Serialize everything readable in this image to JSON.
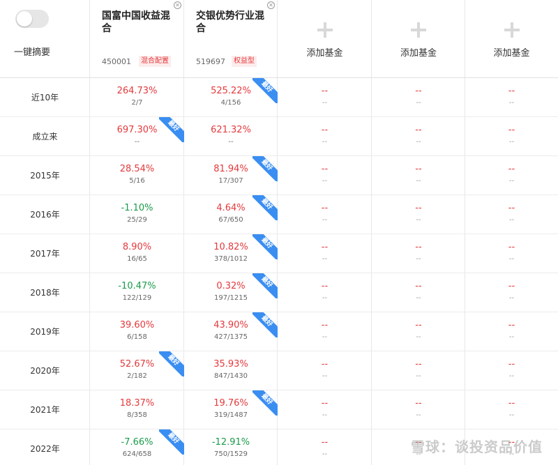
{
  "summary": {
    "label": "一键摘要"
  },
  "funds": [
    {
      "name": "国富中国收益混合",
      "code": "450001",
      "tag": "混合配置"
    },
    {
      "name": "交银优势行业混合",
      "code": "519697",
      "tag": "权益型"
    }
  ],
  "add_slot_label": "添加基金",
  "empty_value": "--",
  "badge_label": "最好",
  "rows": [
    {
      "label": "近10年",
      "f1": {
        "value": "264.73%",
        "rank": "2/7",
        "dir": "up",
        "best": false
      },
      "f2": {
        "value": "525.22%",
        "rank": "4/156",
        "dir": "up",
        "best": true
      }
    },
    {
      "label": "成立来",
      "f1": {
        "value": "697.30%",
        "rank": "--",
        "dir": "up",
        "best": true
      },
      "f2": {
        "value": "621.32%",
        "rank": "--",
        "dir": "up",
        "best": false
      }
    },
    {
      "label": "2015年",
      "f1": {
        "value": "28.54%",
        "rank": "5/16",
        "dir": "up",
        "best": false
      },
      "f2": {
        "value": "81.94%",
        "rank": "17/307",
        "dir": "up",
        "best": true
      }
    },
    {
      "label": "2016年",
      "f1": {
        "value": "-1.10%",
        "rank": "25/29",
        "dir": "down",
        "best": false
      },
      "f2": {
        "value": "4.64%",
        "rank": "67/650",
        "dir": "up",
        "best": true
      }
    },
    {
      "label": "2017年",
      "f1": {
        "value": "8.90%",
        "rank": "16/65",
        "dir": "up",
        "best": false
      },
      "f2": {
        "value": "10.82%",
        "rank": "378/1012",
        "dir": "up",
        "best": true
      }
    },
    {
      "label": "2018年",
      "f1": {
        "value": "-10.47%",
        "rank": "122/129",
        "dir": "down",
        "best": false
      },
      "f2": {
        "value": "0.32%",
        "rank": "197/1215",
        "dir": "up",
        "best": true
      }
    },
    {
      "label": "2019年",
      "f1": {
        "value": "39.60%",
        "rank": "6/158",
        "dir": "up",
        "best": false
      },
      "f2": {
        "value": "43.90%",
        "rank": "427/1375",
        "dir": "up",
        "best": true
      }
    },
    {
      "label": "2020年",
      "f1": {
        "value": "52.67%",
        "rank": "2/182",
        "dir": "up",
        "best": true
      },
      "f2": {
        "value": "35.93%",
        "rank": "847/1430",
        "dir": "up",
        "best": false
      }
    },
    {
      "label": "2021年",
      "f1": {
        "value": "18.37%",
        "rank": "8/358",
        "dir": "up",
        "best": false
      },
      "f2": {
        "value": "19.76%",
        "rank": "319/1487",
        "dir": "up",
        "best": true
      }
    },
    {
      "label": "2022年",
      "f1": {
        "value": "-7.66%",
        "rank": "624/658",
        "dir": "down",
        "best": true
      },
      "f2": {
        "value": "-12.91%",
        "rank": "750/1529",
        "dir": "down",
        "best": false
      }
    }
  ],
  "watermark": "雪球：谈投资品价值",
  "colors": {
    "up": "#e4393c",
    "down": "#1a9b4b",
    "ribbon": "#3a8ef2"
  }
}
